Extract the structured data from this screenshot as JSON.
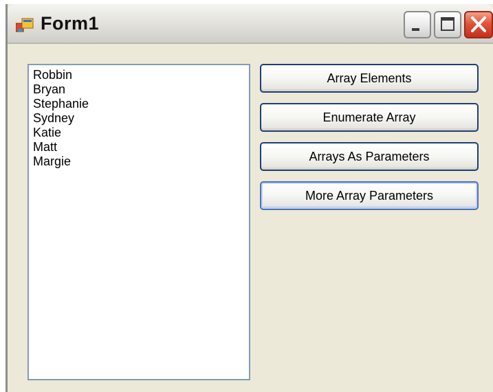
{
  "window": {
    "title": "Form1",
    "icon": "form-app-icon"
  },
  "title_controls": {
    "minimize_icon": "minimize-icon",
    "maximize_icon": "maximize-icon",
    "close_icon": "close-icon",
    "close_color": "#e1543a"
  },
  "listbox": {
    "items": [
      "Robbin",
      "Bryan",
      "Stephanie",
      "Sydney",
      "Katie",
      "Matt",
      "Margie"
    ]
  },
  "buttons": {
    "array_elements": "Array Elements",
    "enumerate_array": "Enumerate Array",
    "arrays_as_parameters": "Arrays As Parameters",
    "more_array_parameters": "More Array Parameters"
  }
}
